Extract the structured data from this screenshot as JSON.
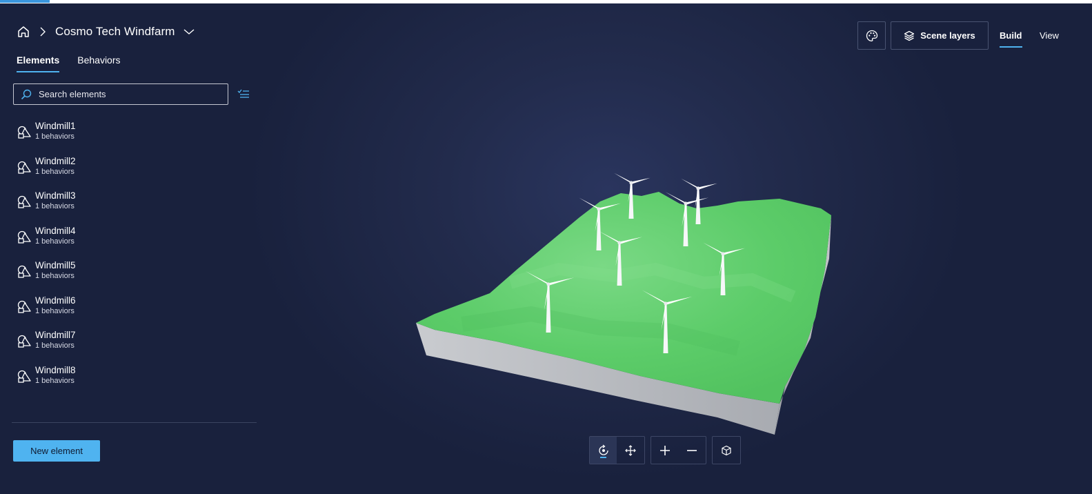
{
  "header": {
    "title": "Cosmo Tech Windfarm",
    "icons": {
      "home": "home-icon",
      "separator": "chevron-right-icon",
      "dropdown": "chevron-down-icon"
    }
  },
  "left_panel": {
    "tabs": [
      {
        "label": "Elements",
        "active": true
      },
      {
        "label": "Behaviors",
        "active": false
      }
    ],
    "search": {
      "placeholder": "Search elements",
      "value": ""
    },
    "elements": [
      {
        "name": "Windmill1",
        "sub": "1 behaviors"
      },
      {
        "name": "Windmill2",
        "sub": "1 behaviors"
      },
      {
        "name": "Windmill3",
        "sub": "1 behaviors"
      },
      {
        "name": "Windmill4",
        "sub": "1 behaviors"
      },
      {
        "name": "Windmill5",
        "sub": "1 behaviors"
      },
      {
        "name": "Windmill6",
        "sub": "1 behaviors"
      },
      {
        "name": "Windmill7",
        "sub": "1 behaviors"
      },
      {
        "name": "Windmill8",
        "sub": "1 behaviors"
      }
    ],
    "new_element_label": "New element"
  },
  "toolbar": {
    "theme_icon": "palette-icon",
    "scene_layers_label": "Scene layers",
    "modes": [
      {
        "label": "Build",
        "active": true
      },
      {
        "label": "View",
        "active": false
      }
    ]
  },
  "viewer_controls": {
    "icons": [
      "orbit-icon",
      "pan-icon",
      "zoom-in-icon",
      "zoom-out-icon",
      "reset-camera-icon"
    ],
    "active": "orbit-icon"
  },
  "colors": {
    "background": "#19213d",
    "accent": "#4fb3f0",
    "terrain": "#5dcd6a",
    "terrain_side": "#b5b8bd"
  }
}
